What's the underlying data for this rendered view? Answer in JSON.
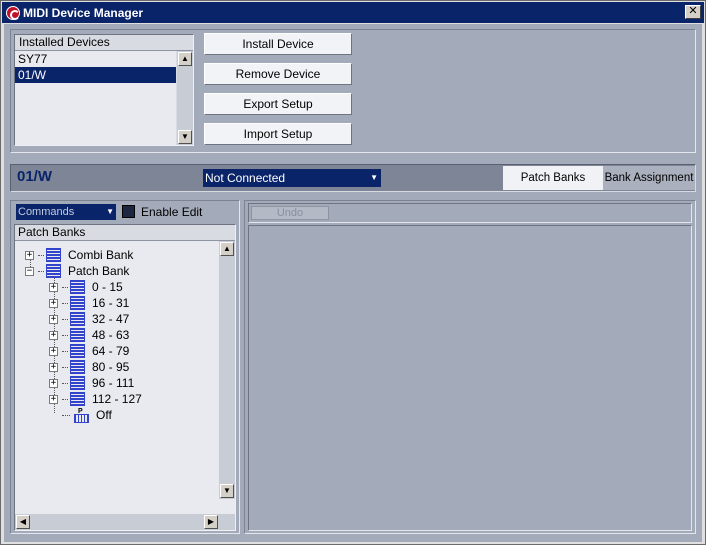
{
  "window": {
    "title": "MIDI Device Manager",
    "close_glyph": "✕"
  },
  "installed_devices": {
    "header": "Installed Devices",
    "items": [
      "SY77",
      "01/W"
    ],
    "selected_index": 1
  },
  "buttons": {
    "install": "Install Device",
    "remove": "Remove Device",
    "export": "Export Setup",
    "import": "Import Setup"
  },
  "device_bar": {
    "device_name": "01/W",
    "connection": "Not Connected",
    "tabs": [
      {
        "label": "Patch Banks",
        "active": true
      },
      {
        "label": "Bank Assignment",
        "active": false
      }
    ]
  },
  "left_panel": {
    "commands_select": "Commands",
    "enable_edit_label": "Enable Edit",
    "enable_edit_checked": false,
    "tree_header": "Patch Banks",
    "tree": {
      "combi_bank": "Combi Bank",
      "patch_bank": "Patch Bank",
      "ranges": [
        "0 - 15",
        "16 - 31",
        "32 - 47",
        "48 - 63",
        "64 - 79",
        "80 - 95",
        "96 - 111",
        "112 - 127"
      ],
      "off": "Off"
    }
  },
  "right_panel": {
    "undo_label": "Undo"
  },
  "icons": {
    "expand": "+",
    "collapse": "−",
    "scroll_up": "▲",
    "scroll_down": "▼",
    "scroll_left": "◀",
    "scroll_right": "▶",
    "dropdown": "▼"
  },
  "colors": {
    "titlebar": "#0a246a",
    "selection": "#0a246a",
    "panel_bg": "#a3aab9",
    "bank_icon": "#3344cc"
  }
}
